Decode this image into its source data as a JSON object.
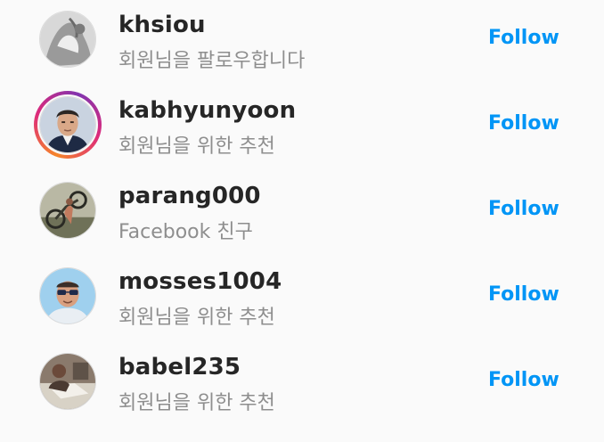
{
  "suggestions": [
    {
      "username": "khsiou",
      "subtitle": "회원님을 팔로우합니다",
      "follow_label": "Follow",
      "story_ring": false,
      "avatar_icon": "user-photo-icon"
    },
    {
      "username": "kabhyunyoon",
      "subtitle": "회원님을 위한 추천",
      "follow_label": "Follow",
      "story_ring": true,
      "avatar_icon": "user-photo-icon"
    },
    {
      "username": "parang000",
      "subtitle": "Facebook 친구",
      "follow_label": "Follow",
      "story_ring": false,
      "avatar_icon": "user-photo-icon"
    },
    {
      "username": "mosses1004",
      "subtitle": "회원님을 위한 추천",
      "follow_label": "Follow",
      "story_ring": false,
      "avatar_icon": "user-photo-icon"
    },
    {
      "username": "babel235",
      "subtitle": "회원님을 위한 추천",
      "follow_label": "Follow",
      "story_ring": false,
      "avatar_icon": "user-photo-icon"
    }
  ],
  "colors": {
    "follow": "#0095f6",
    "username": "#262626",
    "subtitle": "#8e8e8e",
    "background": "#fafafa",
    "story_ring": [
      "#f58529",
      "#dd2a7b",
      "#8134af"
    ]
  }
}
